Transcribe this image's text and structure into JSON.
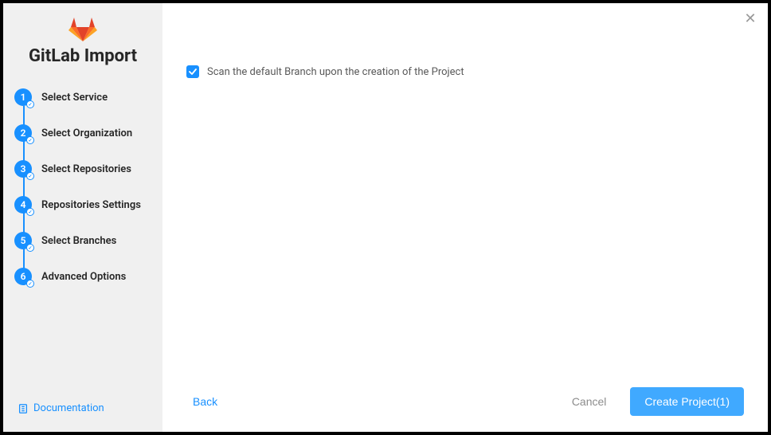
{
  "title": "GitLab Import",
  "steps": [
    {
      "num": "1",
      "label": "Select Service"
    },
    {
      "num": "2",
      "label": "Select Organization"
    },
    {
      "num": "3",
      "label": "Select Repositories"
    },
    {
      "num": "4",
      "label": "Repositories Settings"
    },
    {
      "num": "5",
      "label": "Select Branches"
    },
    {
      "num": "6",
      "label": "Advanced Options"
    }
  ],
  "documentation_label": "Documentation",
  "checkbox_label": "Scan the default Branch upon the creation of the Project",
  "back_label": "Back",
  "cancel_label": "Cancel",
  "create_label": "Create Project(1)",
  "colors": {
    "accent": "#1890ff",
    "button": "#40a9ff"
  }
}
